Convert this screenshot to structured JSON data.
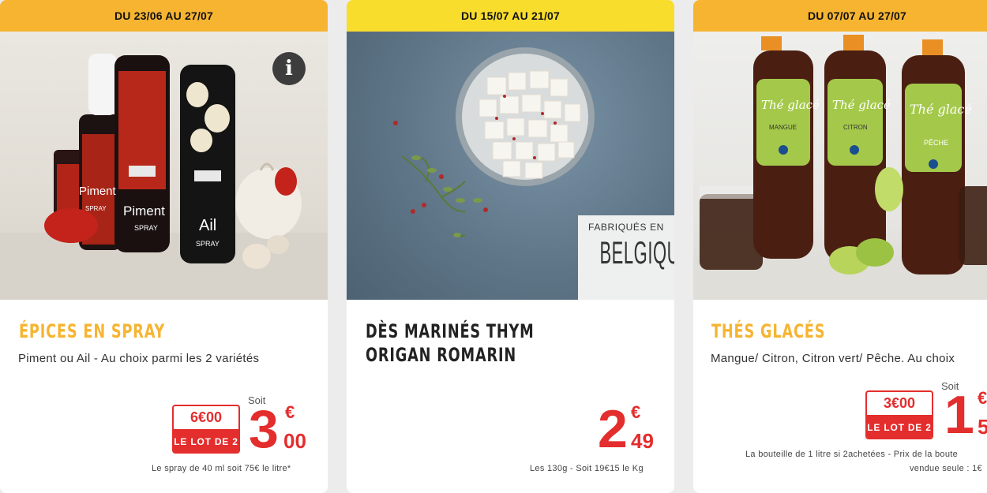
{
  "cards": [
    {
      "date": "DU 23/06 AU 27/07",
      "title": "ÉPICES EN SPRAY",
      "subtitle": "Piment ou Ail - Au choix parmi les 2 variétés",
      "soit": "Soit",
      "old_price": "6€00",
      "lot": "LE LOT DE 2",
      "price_int": "3",
      "price_cur": "€",
      "price_dec": "00",
      "footnote": "Le spray de 40 ml soit 75€ le litre*",
      "bottle_labels": [
        "Piment",
        "SPRAY",
        "Piment",
        "SPRAY",
        "Ail",
        "SPRAY"
      ],
      "info_icon": "i"
    },
    {
      "date": "DU 15/07 AU 21/07",
      "title": "DÈS MARINÉS THYM ORIGAN ROMARIN",
      "origin_small": "FABRIQUÉS EN",
      "origin_big": "BELGIQUE",
      "price_int": "2",
      "price_cur": "€",
      "price_dec": "49",
      "footnote": "Les 130g - Soit 19€15 le Kg"
    },
    {
      "date": "DU 07/07 AU 27/07",
      "title": "THÉS GLACÉS",
      "subtitle": "Mangue/ Citron, Citron vert/ Pêche. Au choix",
      "soit": "Soit",
      "old_price": "3€00",
      "lot": "LE LOT DE 2",
      "price_int": "1",
      "price_cur": "€",
      "price_dec": "5",
      "footnote_line1": "La bouteille de 1 litre si 2achetées - Prix de la boute",
      "footnote_line2": "vendue seule : 1€",
      "bottle_labels": [
        "Thé glacé",
        "MANGUE",
        "Thé glacé",
        "CITRON",
        "Thé glacé",
        "PÊCHE"
      ]
    }
  ],
  "colors": {
    "accent_orange": "#f6b431",
    "accent_yellow": "#f8dd2c",
    "price_red": "#e42d2d"
  },
  "icons": {
    "info": "info-icon"
  }
}
